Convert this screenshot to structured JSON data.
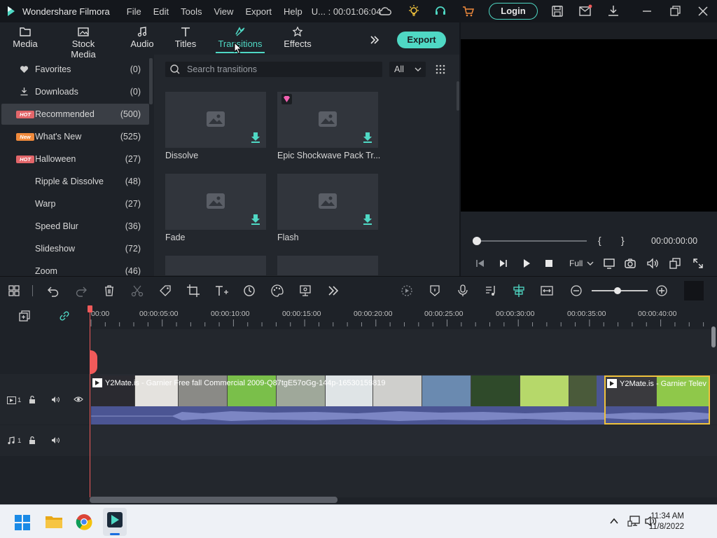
{
  "app": {
    "title": "Wondershare Filmora",
    "menu": [
      "File",
      "Edit",
      "Tools",
      "View",
      "Export",
      "Help"
    ],
    "project": "U... : 00:01:06:04",
    "login_label": "Login"
  },
  "tabs": [
    {
      "label": "Media",
      "icon": "folder-icon"
    },
    {
      "label": "Stock Media",
      "icon": "image-icon"
    },
    {
      "label": "Audio",
      "icon": "music-note-icon"
    },
    {
      "label": "Titles",
      "icon": "text-icon"
    },
    {
      "label": "Transitions",
      "icon": "transitions-icon",
      "active": true
    },
    {
      "label": "Effects",
      "icon": "effects-icon"
    }
  ],
  "export_label": "Export",
  "sidebar": {
    "items": [
      {
        "label": "Favorites",
        "count": "(0)",
        "icon": "heart-icon"
      },
      {
        "label": "Downloads",
        "count": "(0)",
        "icon": "download-icon"
      },
      {
        "label": "Recommended",
        "count": "(500)",
        "badge": "HOT",
        "active": true
      },
      {
        "label": "What's New",
        "count": "(525)",
        "badge": "New"
      },
      {
        "label": "Halloween",
        "count": "(27)",
        "badge": "HOT"
      },
      {
        "label": "Ripple & Dissolve",
        "count": "(48)"
      },
      {
        "label": "Warp",
        "count": "(27)"
      },
      {
        "label": "Speed Blur",
        "count": "(36)"
      },
      {
        "label": "Slideshow",
        "count": "(72)"
      },
      {
        "label": "Zoom",
        "count": "(46)"
      }
    ]
  },
  "search": {
    "placeholder": "Search transitions",
    "filter_value": "All"
  },
  "transitions": [
    {
      "label": "Dissolve",
      "premium": false
    },
    {
      "label": "Epic Shockwave Pack Tr...",
      "premium": true
    },
    {
      "label": "Fade",
      "premium": false
    },
    {
      "label": "Flash",
      "premium": false
    }
  ],
  "preview": {
    "timecode": "00:00:00:00",
    "quality": "Full",
    "bracket_in": "{",
    "bracket_out": "}"
  },
  "timeline": {
    "ruler": [
      "00:00",
      "00:00:05:00",
      "00:00:10:00",
      "00:00:15:00",
      "00:00:20:00",
      "00:00:25:00",
      "00:00:30:00",
      "00:00:35:00",
      "00:00:40:00"
    ],
    "video_track_label": "1",
    "audio_track_label": "1",
    "clip1_title": "Y2Mate.is - Garnier Free fall Commercial 2009-Q87tgE57oGg-144p-1653015981921",
    "clip2_title": "Y2Mate.is - Garnier  Telev"
  },
  "taskbar": {
    "time": "11:34 AM",
    "date": "11/8/2022"
  },
  "colors": {
    "accent": "#4fd8c4",
    "playhead": "#f05a5a",
    "video_track": "#4b5593",
    "hot_badge": "#e2666a",
    "new_badge": "#f08a3c"
  }
}
